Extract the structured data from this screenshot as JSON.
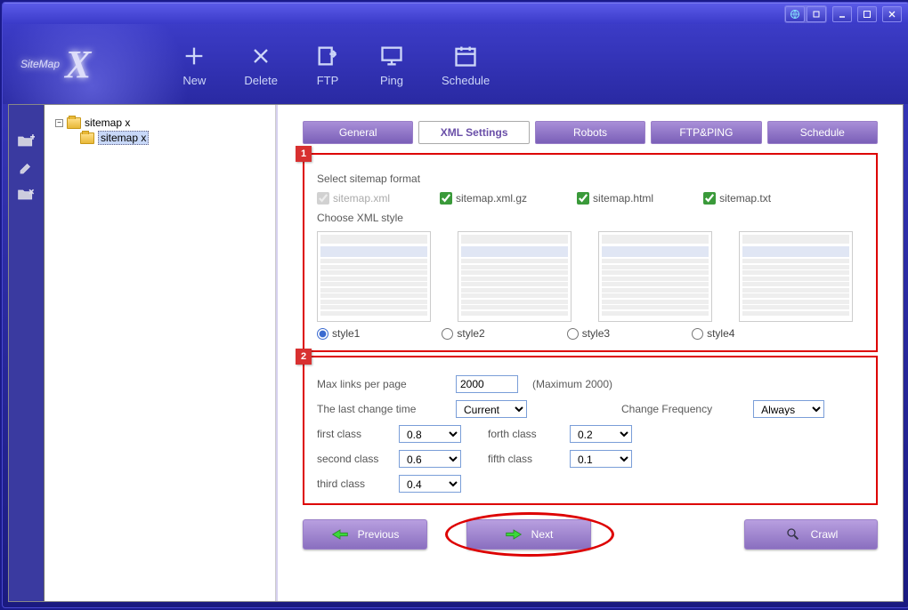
{
  "app": {
    "title": "SiteMap",
    "title_x": "X"
  },
  "titlebar": {
    "globe": "globe",
    "min": "_",
    "max": "□",
    "close": "×"
  },
  "toolbar": {
    "new": "New",
    "delete": "Delete",
    "ftp": "FTP",
    "ping": "Ping",
    "schedule": "Schedule"
  },
  "tree": {
    "root": "sitemap x",
    "child": "sitemap x",
    "toggle": "−"
  },
  "tabs": {
    "general": "General",
    "xml": "XML Settings",
    "robots": "Robots",
    "ftpping": "FTP&PING",
    "schedule": "Schedule",
    "active": "xml"
  },
  "section1": {
    "badge": "1",
    "select_format_label": "Select sitemap format",
    "formats": {
      "sitemap_xml": {
        "label": "sitemap.xml",
        "checked": true,
        "disabled": true
      },
      "sitemap_xml_gz": {
        "label": "sitemap.xml.gz",
        "checked": true,
        "disabled": false
      },
      "sitemap_html": {
        "label": "sitemap.html",
        "checked": true,
        "disabled": false
      },
      "sitemap_txt": {
        "label": "sitemap.txt",
        "checked": true,
        "disabled": false
      }
    },
    "choose_style_label": "Choose XML style",
    "styles": {
      "style1": "style1",
      "style2": "style2",
      "style3": "style3",
      "style4": "style4",
      "selected": "style1"
    }
  },
  "section2": {
    "badge": "2",
    "max_links_label": "Max links per page",
    "max_links_value": "2000",
    "max_links_hint": "(Maximum 2000)",
    "last_change_label": "The last change time",
    "last_change_value": "Current",
    "change_freq_label": "Change Frequency",
    "change_freq_value": "Always",
    "classes": {
      "first": {
        "label": "first class",
        "value": "0.8"
      },
      "second": {
        "label": "second class",
        "value": "0.6"
      },
      "third": {
        "label": "third class",
        "value": "0.4"
      },
      "forth": {
        "label": "forth class",
        "value": "0.2"
      },
      "fifth": {
        "label": "fifth class",
        "value": "0.1"
      }
    }
  },
  "footer": {
    "previous": "Previous",
    "next": "Next",
    "crawl": "Crawl"
  }
}
